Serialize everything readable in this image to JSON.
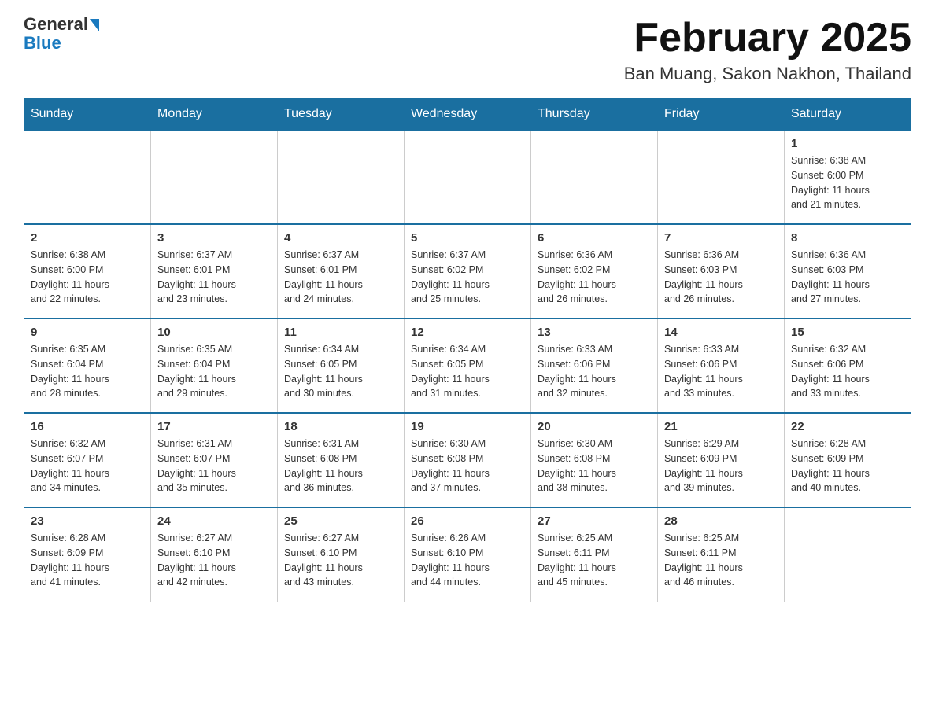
{
  "header": {
    "logo_general": "General",
    "logo_blue": "Blue",
    "month_title": "February 2025",
    "location": "Ban Muang, Sakon Nakhon, Thailand"
  },
  "calendar": {
    "days_of_week": [
      "Sunday",
      "Monday",
      "Tuesday",
      "Wednesday",
      "Thursday",
      "Friday",
      "Saturday"
    ],
    "weeks": [
      [
        {
          "day": "",
          "info": ""
        },
        {
          "day": "",
          "info": ""
        },
        {
          "day": "",
          "info": ""
        },
        {
          "day": "",
          "info": ""
        },
        {
          "day": "",
          "info": ""
        },
        {
          "day": "",
          "info": ""
        },
        {
          "day": "1",
          "info": "Sunrise: 6:38 AM\nSunset: 6:00 PM\nDaylight: 11 hours\nand 21 minutes."
        }
      ],
      [
        {
          "day": "2",
          "info": "Sunrise: 6:38 AM\nSunset: 6:00 PM\nDaylight: 11 hours\nand 22 minutes."
        },
        {
          "day": "3",
          "info": "Sunrise: 6:37 AM\nSunset: 6:01 PM\nDaylight: 11 hours\nand 23 minutes."
        },
        {
          "day": "4",
          "info": "Sunrise: 6:37 AM\nSunset: 6:01 PM\nDaylight: 11 hours\nand 24 minutes."
        },
        {
          "day": "5",
          "info": "Sunrise: 6:37 AM\nSunset: 6:02 PM\nDaylight: 11 hours\nand 25 minutes."
        },
        {
          "day": "6",
          "info": "Sunrise: 6:36 AM\nSunset: 6:02 PM\nDaylight: 11 hours\nand 26 minutes."
        },
        {
          "day": "7",
          "info": "Sunrise: 6:36 AM\nSunset: 6:03 PM\nDaylight: 11 hours\nand 26 minutes."
        },
        {
          "day": "8",
          "info": "Sunrise: 6:36 AM\nSunset: 6:03 PM\nDaylight: 11 hours\nand 27 minutes."
        }
      ],
      [
        {
          "day": "9",
          "info": "Sunrise: 6:35 AM\nSunset: 6:04 PM\nDaylight: 11 hours\nand 28 minutes."
        },
        {
          "day": "10",
          "info": "Sunrise: 6:35 AM\nSunset: 6:04 PM\nDaylight: 11 hours\nand 29 minutes."
        },
        {
          "day": "11",
          "info": "Sunrise: 6:34 AM\nSunset: 6:05 PM\nDaylight: 11 hours\nand 30 minutes."
        },
        {
          "day": "12",
          "info": "Sunrise: 6:34 AM\nSunset: 6:05 PM\nDaylight: 11 hours\nand 31 minutes."
        },
        {
          "day": "13",
          "info": "Sunrise: 6:33 AM\nSunset: 6:06 PM\nDaylight: 11 hours\nand 32 minutes."
        },
        {
          "day": "14",
          "info": "Sunrise: 6:33 AM\nSunset: 6:06 PM\nDaylight: 11 hours\nand 33 minutes."
        },
        {
          "day": "15",
          "info": "Sunrise: 6:32 AM\nSunset: 6:06 PM\nDaylight: 11 hours\nand 33 minutes."
        }
      ],
      [
        {
          "day": "16",
          "info": "Sunrise: 6:32 AM\nSunset: 6:07 PM\nDaylight: 11 hours\nand 34 minutes."
        },
        {
          "day": "17",
          "info": "Sunrise: 6:31 AM\nSunset: 6:07 PM\nDaylight: 11 hours\nand 35 minutes."
        },
        {
          "day": "18",
          "info": "Sunrise: 6:31 AM\nSunset: 6:08 PM\nDaylight: 11 hours\nand 36 minutes."
        },
        {
          "day": "19",
          "info": "Sunrise: 6:30 AM\nSunset: 6:08 PM\nDaylight: 11 hours\nand 37 minutes."
        },
        {
          "day": "20",
          "info": "Sunrise: 6:30 AM\nSunset: 6:08 PM\nDaylight: 11 hours\nand 38 minutes."
        },
        {
          "day": "21",
          "info": "Sunrise: 6:29 AM\nSunset: 6:09 PM\nDaylight: 11 hours\nand 39 minutes."
        },
        {
          "day": "22",
          "info": "Sunrise: 6:28 AM\nSunset: 6:09 PM\nDaylight: 11 hours\nand 40 minutes."
        }
      ],
      [
        {
          "day": "23",
          "info": "Sunrise: 6:28 AM\nSunset: 6:09 PM\nDaylight: 11 hours\nand 41 minutes."
        },
        {
          "day": "24",
          "info": "Sunrise: 6:27 AM\nSunset: 6:10 PM\nDaylight: 11 hours\nand 42 minutes."
        },
        {
          "day": "25",
          "info": "Sunrise: 6:27 AM\nSunset: 6:10 PM\nDaylight: 11 hours\nand 43 minutes."
        },
        {
          "day": "26",
          "info": "Sunrise: 6:26 AM\nSunset: 6:10 PM\nDaylight: 11 hours\nand 44 minutes."
        },
        {
          "day": "27",
          "info": "Sunrise: 6:25 AM\nSunset: 6:11 PM\nDaylight: 11 hours\nand 45 minutes."
        },
        {
          "day": "28",
          "info": "Sunrise: 6:25 AM\nSunset: 6:11 PM\nDaylight: 11 hours\nand 46 minutes."
        },
        {
          "day": "",
          "info": ""
        }
      ]
    ]
  }
}
